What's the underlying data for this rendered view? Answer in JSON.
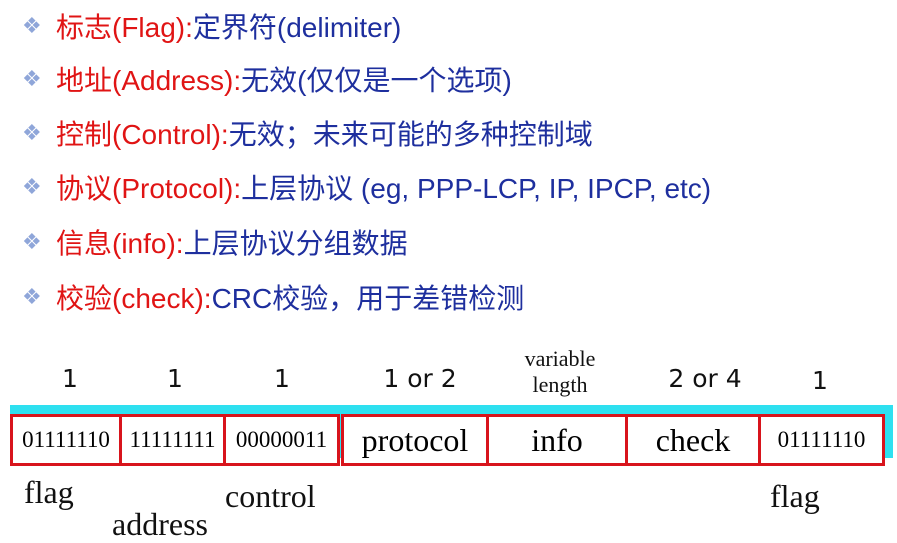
{
  "bullets": [
    {
      "term": "标志(Flag):",
      "desc": " 定界符(delimiter)"
    },
    {
      "term": "地址(Address):",
      "desc": "  无效(仅仅是一个选项)"
    },
    {
      "term": "控制(Control):",
      "desc": " 无效；未来可能的多种控制域"
    },
    {
      "term": "协议(Protocol):",
      "desc": " 上层协议 (eg, PPP-LCP, IP, IPCP, etc)"
    },
    {
      "term": "信息(info):",
      "desc": " 上层协议分组数据"
    },
    {
      "term": "校验(check):",
      "desc": "  CRC校验，用于差错检测"
    }
  ],
  "sizes": [
    "1",
    "1",
    "1",
    "1 or 2",
    "variable length",
    "2 or 4",
    "1"
  ],
  "fields": [
    "01111110",
    "11111111",
    "00000011",
    "protocol",
    "info",
    "check",
    "01111110"
  ],
  "labels": {
    "flag_left": "flag",
    "address": "address",
    "control": "control",
    "flag_right": "flag"
  },
  "colors": {
    "term": "#e01414",
    "desc": "#1e2f9e",
    "border": "#d8141c",
    "band": "#2ee0f0"
  }
}
